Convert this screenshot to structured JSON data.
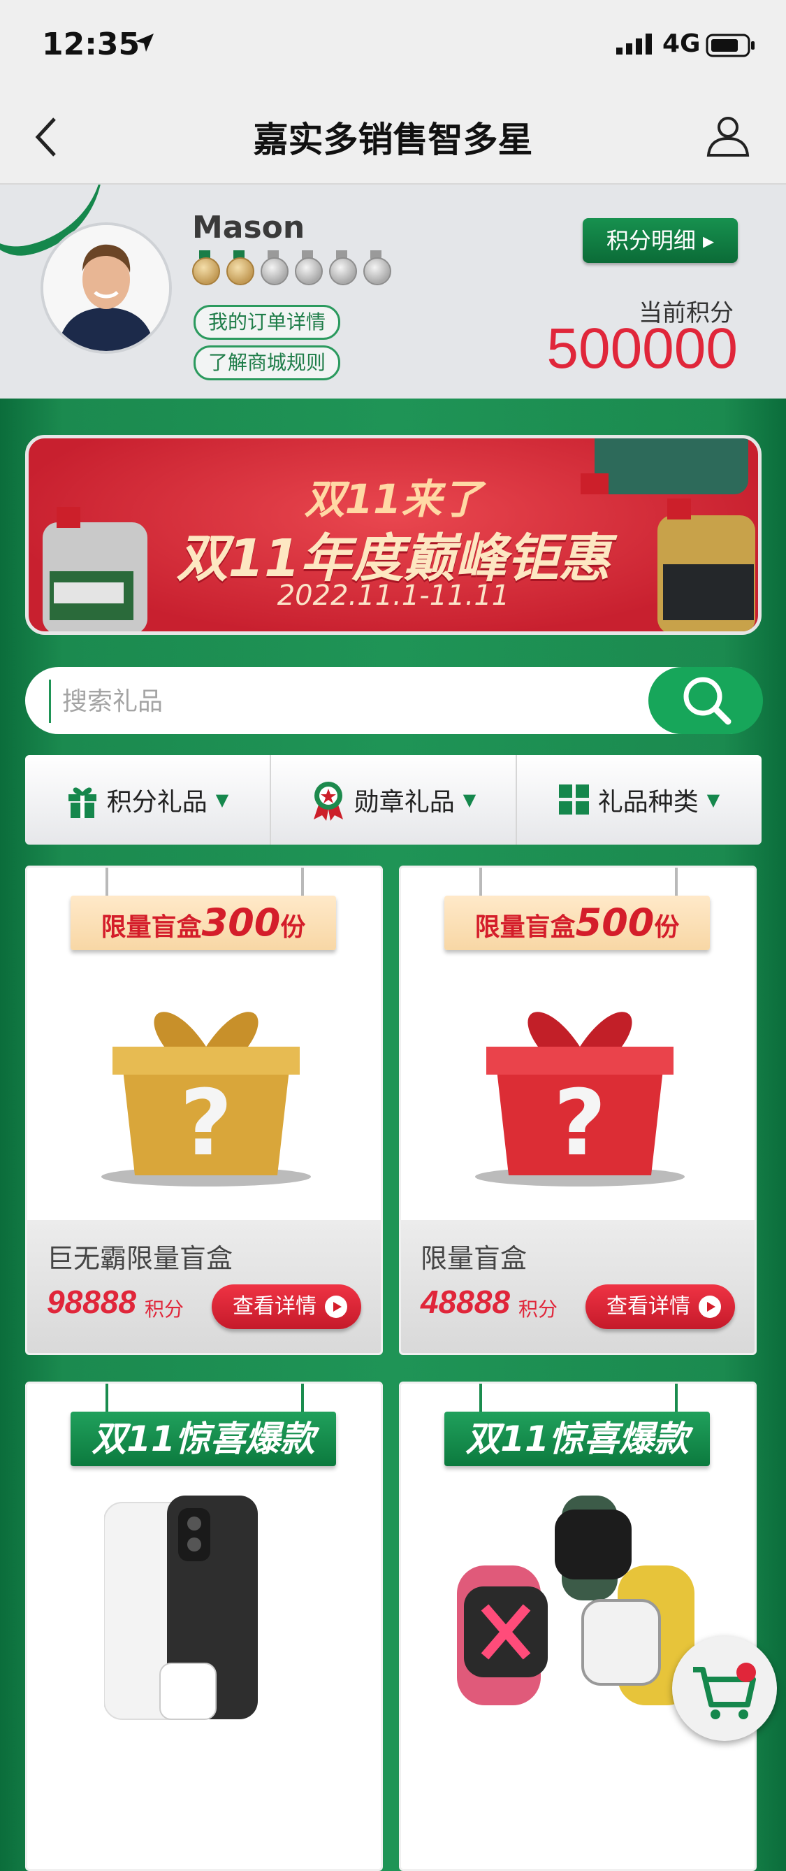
{
  "status": {
    "time": "12:35",
    "network": "4G"
  },
  "nav": {
    "title": "嘉实多销售智多星"
  },
  "profile": {
    "name": "Mason",
    "medals": [
      "gold",
      "gold",
      "silver",
      "silver",
      "silver",
      "silver"
    ],
    "link_orders": "我的订单详情",
    "link_rules": "了解商城规则",
    "points_detail_button": "积分明细 ▸",
    "points_label": "当前积分",
    "points_value": "500000"
  },
  "banner": {
    "tagline": "双11来了",
    "headline": "双11年度巅峰钜惠",
    "date": "2022.11.1-11.11"
  },
  "search": {
    "placeholder": "搜索礼品"
  },
  "filters": [
    {
      "label": "积分礼品",
      "icon": "gift-icon"
    },
    {
      "label": "勋章礼品",
      "icon": "medal-icon"
    },
    {
      "label": "礼品种类",
      "icon": "grid-icon"
    }
  ],
  "products": [
    {
      "tag_prefix": "限量盲盒",
      "tag_num": "300",
      "tag_suffix": "份",
      "name": "巨无霸限量盲盒",
      "price": "98888",
      "unit": "积分",
      "button": "查看详情",
      "box_color": "#d9a63a"
    },
    {
      "tag_prefix": "限量盲盒",
      "tag_num": "500",
      "tag_suffix": "份",
      "name": "限量盲盒",
      "price": "48888",
      "unit": "积分",
      "button": "查看详情",
      "box_color": "#dc2d35"
    },
    {
      "tag": "双11惊喜爆款"
    },
    {
      "tag": "双11惊喜爆款"
    }
  ],
  "colors": {
    "brand_green": "#1f9456",
    "accent_red": "#e0263a"
  }
}
